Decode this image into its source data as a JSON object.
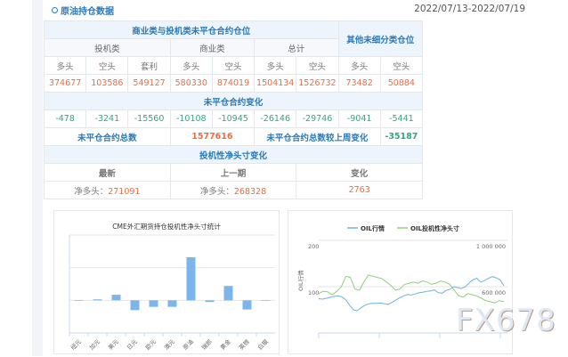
{
  "header": {
    "title": "原油持仓数据",
    "icon": "circle-icon",
    "date_range": "2022/07/13-2022/07/19"
  },
  "table": {
    "group_title": "商业类与投机类未平仓合约仓位",
    "other_title": "其他未细分类仓位",
    "categories": [
      "投机类",
      "商业类",
      "总计"
    ],
    "subheads": [
      "多头",
      "空头",
      "套利",
      "多头",
      "空头",
      "多头",
      "空头",
      "多头",
      "空头"
    ],
    "positions": [
      "374677",
      "103586",
      "549127",
      "580330",
      "874019",
      "1504134",
      "1526732",
      "73482",
      "50884"
    ],
    "change_title": "未平仓合约变化",
    "changes": [
      "-478",
      "-3241",
      "-15560",
      "-10108",
      "-10945",
      "-26146",
      "-29746",
      "-9041",
      "-5441"
    ],
    "total_label": "未平仓合约总数",
    "total_value": "1577616",
    "weekly_label": "未平仓合约总数较上周变化",
    "weekly_value": "-35187",
    "net_title": "投机性净头寸变化",
    "net_heads": [
      "最新",
      "上一期",
      "变化"
    ],
    "net_prefix": "净多头：",
    "latest": "271091",
    "previous": "268328",
    "diff": "2763"
  },
  "chart_data": [
    {
      "type": "bar",
      "title": "CME外汇期货持仓投机性净头寸统计",
      "categories": [
        "纽元",
        "加元",
        "美元",
        "日元",
        "欧元",
        "澳元",
        "原油",
        "瑞郎",
        "黄金",
        "英镑",
        "白银"
      ],
      "values": [
        0,
        0.03,
        0.17,
        -0.3,
        -0.2,
        -0.2,
        1.32,
        -0.05,
        0.44,
        -0.28,
        0
      ],
      "ylim": [
        -1,
        2
      ],
      "grid": true,
      "color": "#7cb5ec"
    },
    {
      "type": "line",
      "legend": [
        "OIL行情",
        "OIL投机性净头寸"
      ],
      "legend_position": "top",
      "ylabel": "OIL行情",
      "left_ticks": [
        "200",
        "100"
      ],
      "right_ticks": [
        "1 000 000",
        "600 000"
      ],
      "ylim_left": [
        0,
        200
      ],
      "ylim_right": [
        200000,
        1000000
      ],
      "series": [
        {
          "name": "OIL行情",
          "axis": "left",
          "color": "#6db3e0",
          "values": [
            74,
            73,
            75,
            77,
            79,
            80,
            78,
            72,
            60,
            50,
            48,
            55,
            60,
            63,
            64,
            64,
            65,
            63,
            62,
            66,
            71,
            76,
            80,
            83,
            82,
            84,
            87,
            88,
            90,
            91,
            93,
            87,
            86,
            92,
            94,
            100,
            98,
            96,
            100,
            108,
            115,
            118,
            110,
            113,
            118,
            122,
            119,
            115,
            102
          ]
        },
        {
          "name": "OIL投机性净头寸",
          "axis": "right",
          "color": "#8fd07a",
          "values": [
            540000,
            560000,
            555000,
            530000,
            560000,
            600000,
            690000,
            680000,
            580000,
            570000,
            640000,
            700000,
            690000,
            680000,
            670000,
            640000,
            610000,
            570000,
            580000,
            620000,
            630000,
            640000,
            630000,
            650000,
            640000,
            620000,
            630000,
            650000,
            640000,
            620000,
            570000,
            520000,
            510000,
            540000,
            530000,
            520000,
            500000,
            480000,
            470000,
            460000,
            480000,
            470000
          ]
        }
      ]
    }
  ]
}
